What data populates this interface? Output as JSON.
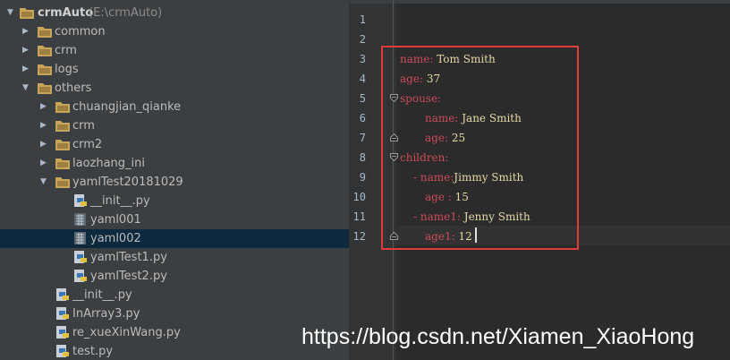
{
  "project_tree": {
    "root": {
      "name": "crmAuto",
      "path": "(E:\\crmAuto)"
    },
    "items": [
      {
        "label": "common",
        "icon": "folder-icon"
      },
      {
        "label": "crm",
        "icon": "folder-icon"
      },
      {
        "label": "logs",
        "icon": "folder-icon"
      },
      {
        "label": "others",
        "icon": "folder-icon"
      },
      {
        "label": "chuangjian_qianke",
        "icon": "folder-icon"
      },
      {
        "label": "crm",
        "icon": "folder-icon"
      },
      {
        "label": "crm2",
        "icon": "folder-icon"
      },
      {
        "label": "laozhang_ini",
        "icon": "folder-icon"
      },
      {
        "label": "yamlTest20181029",
        "icon": "folder-icon"
      },
      {
        "label": "__init__.py",
        "icon": "python-file-icon"
      },
      {
        "label": "yaml001",
        "icon": "text-file-icon"
      },
      {
        "label": "yaml002",
        "icon": "text-file-icon"
      },
      {
        "label": "yamlTest1.py",
        "icon": "python-file-icon"
      },
      {
        "label": "yamlTest2.py",
        "icon": "python-file-icon"
      },
      {
        "label": "__init__.py",
        "icon": "python-file-icon"
      },
      {
        "label": "InArray3.py",
        "icon": "python-file-icon"
      },
      {
        "label": "re_xueXinWang.py",
        "icon": "python-file-icon"
      },
      {
        "label": "test.py",
        "icon": "python-file-icon"
      }
    ],
    "selected_item": "yaml002"
  },
  "editor": {
    "line_numbers": [
      "1",
      "2",
      "3",
      "4",
      "5",
      "6",
      "7",
      "8",
      "9",
      "10",
      "11",
      "12"
    ],
    "tokens": {
      "l3_key": "name:",
      "l3_val": "Tom Smith",
      "l4_key": "age:",
      "l4_val": "37",
      "l5_key": "spouse:",
      "l6_key": "name:",
      "l6_val": "Jane Smith",
      "l7_key": "age:",
      "l7_val": "25",
      "l8_key": "children:",
      "l9_dash": "-",
      "l9_key": "name:",
      "l9_val": "Jimmy Smith",
      "l10_key": "age :",
      "l10_val": "15",
      "l11_dash": "-",
      "l11_key": "name1:",
      "l11_val": "Jenny Smith",
      "l12_key": "age1:",
      "l12_val": "12"
    },
    "current_line": "12"
  },
  "watermark": "https://blog.csdn.net/Xiamen_XiaoHong",
  "colors": {
    "selection": "#0d293e",
    "highlight_box": "#e03b3b",
    "yaml_key": "#cc4b5d",
    "yaml_value": "#e6d8a8"
  }
}
